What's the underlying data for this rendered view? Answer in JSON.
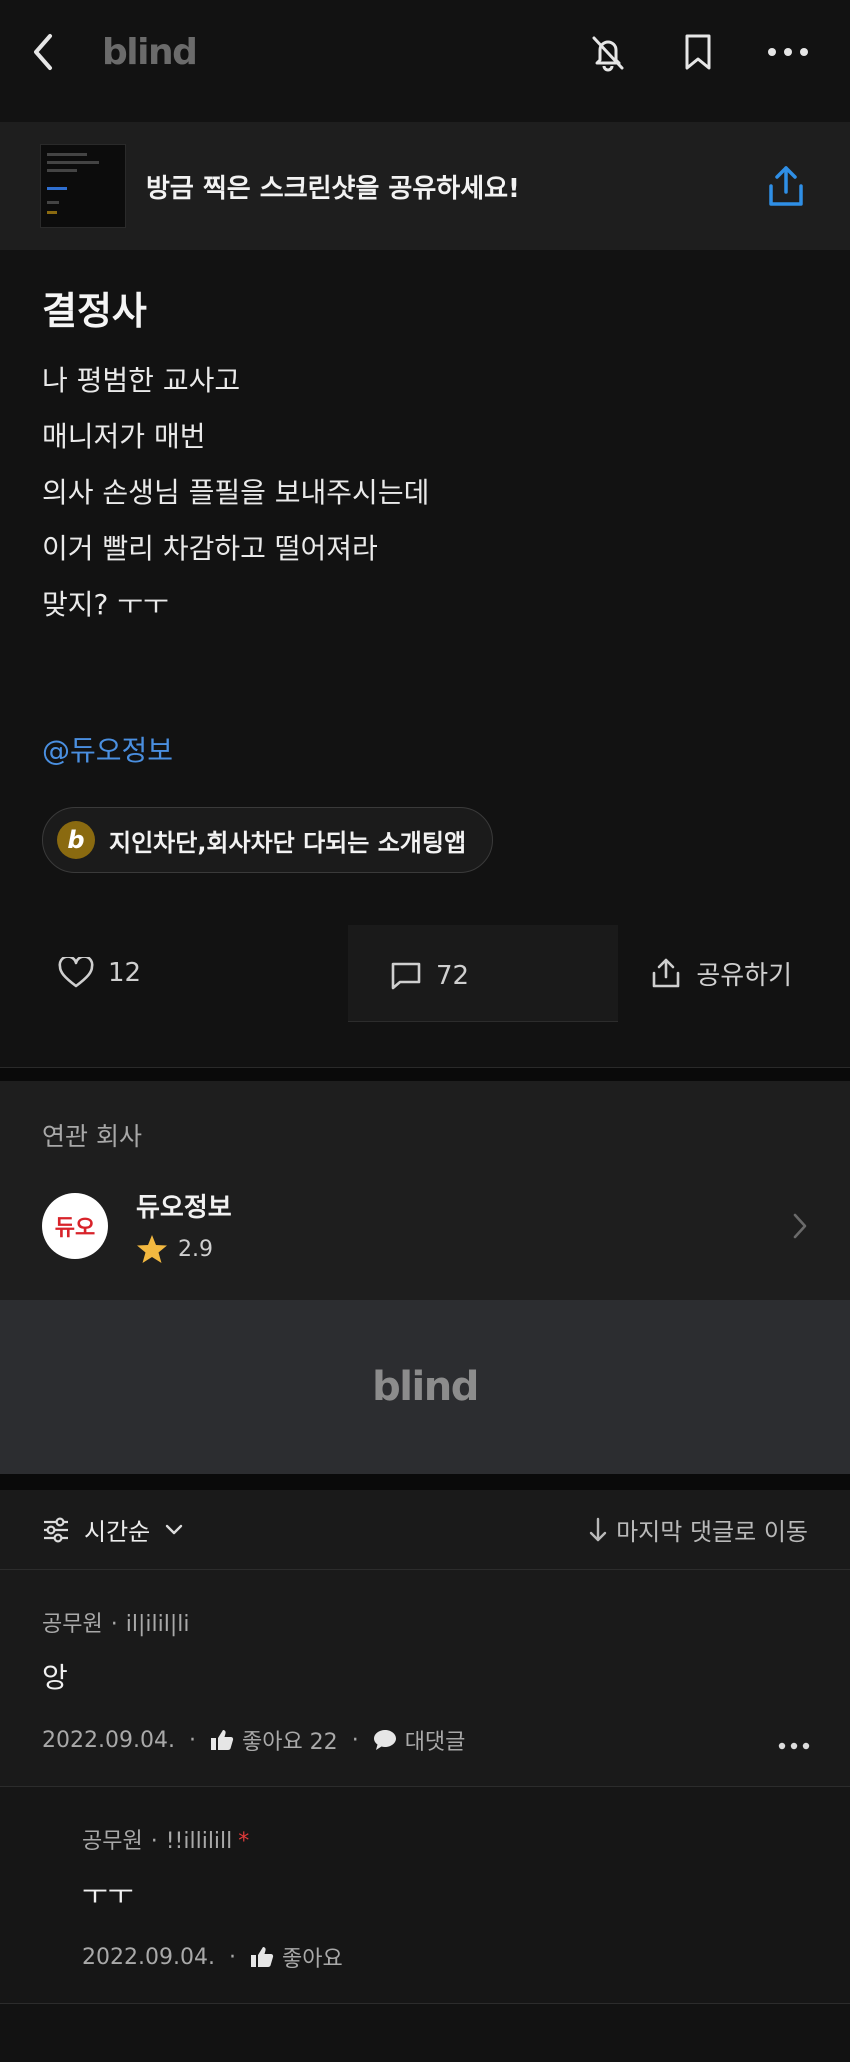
{
  "header": {
    "logo": "blind"
  },
  "banner": {
    "text": "방금 찍은 스크린샷을 공유하세요!"
  },
  "post": {
    "title": "결정사",
    "lines": [
      "나 평범한 교사고",
      "매니저가 매번",
      "의사 손생님 플필을 보내주시는데",
      "이거 빨리 차감하고 떨어져라",
      "맞지? ㅜㅜ"
    ],
    "mention": "@듀오정보",
    "ad_chip": {
      "logo_letter": "b",
      "text": "지인차단,회사차단 다되는 소개팅앱"
    }
  },
  "actions": {
    "likes": "12",
    "comments": "72",
    "share_label": "공유하기"
  },
  "related": {
    "title": "연관 회사",
    "company_name": "듀오정보",
    "company_logo_text": "듀오",
    "rating": "2.9"
  },
  "ad_banner": {
    "logo": "blind"
  },
  "sort": {
    "label": "시간순",
    "jump_label": "마지막 댓글로 이동"
  },
  "comments": [
    {
      "author": "공무원",
      "nickname": "il|ilil|li",
      "text": "앙",
      "date": "2022.09.04.",
      "like_label": "좋아요 22",
      "reply_label": "대댓글"
    }
  ],
  "replies": [
    {
      "author": "공무원",
      "nickname": "!!illilill",
      "badge": "*",
      "text": "ㅜㅜ",
      "date": "2022.09.04.",
      "like_label": "좋아요"
    }
  ],
  "colors": {
    "background": "#121212",
    "accent_blue": "#2f8fe6",
    "mention_blue": "#4a8fe0",
    "star": "#f2b840"
  }
}
